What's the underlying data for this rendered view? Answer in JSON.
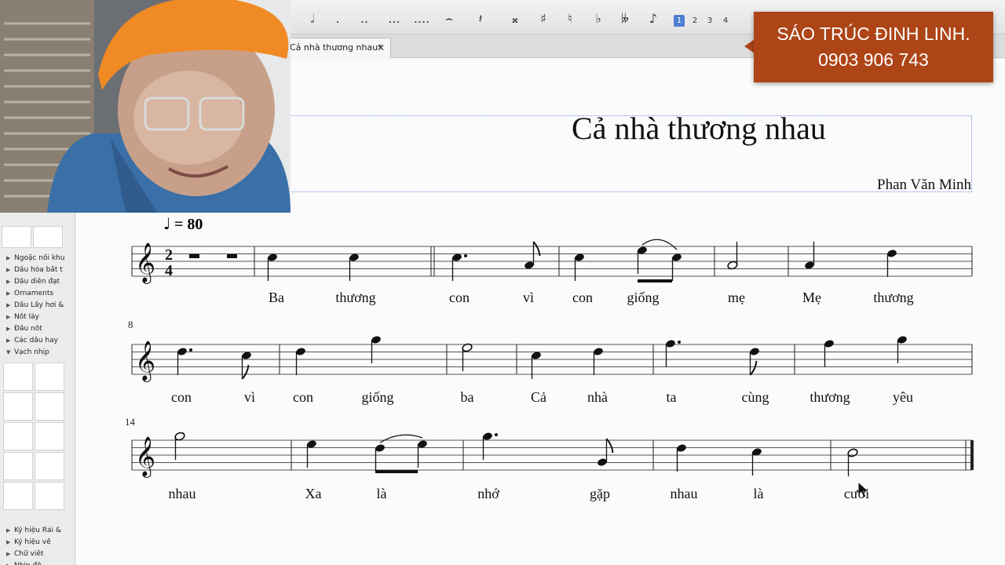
{
  "toolbar": {
    "buttons": [
      {
        "name": "half-note-button",
        "glyph": "𝅗𝅥"
      },
      {
        "name": "dot-button",
        "glyph": "."
      },
      {
        "name": "double-dot-button",
        "glyph": ".."
      },
      {
        "name": "triple-dot-button",
        "glyph": "..."
      },
      {
        "name": "quad-dot-button",
        "glyph": "...."
      },
      {
        "name": "tie-button",
        "glyph": "⌢"
      },
      {
        "name": "rest-button",
        "glyph": "𝄽"
      },
      {
        "name": "double-sharp-button",
        "glyph": "𝄪"
      },
      {
        "name": "sharp-button",
        "glyph": "♯"
      },
      {
        "name": "natural-button",
        "glyph": "♮"
      },
      {
        "name": "flat-button",
        "glyph": "♭"
      },
      {
        "name": "double-flat-button",
        "glyph": "𝄫"
      },
      {
        "name": "grace-note-button",
        "glyph": "♪"
      }
    ],
    "voices": [
      "1",
      "2",
      "3",
      "4"
    ]
  },
  "tab": {
    "label": "Cả nhà thương nhau*",
    "close": "✕"
  },
  "palette": {
    "rows": [
      "Ngoặc nối khu",
      "Dấu hóa bất t",
      "Dấu diễn đạt",
      "Ornaments",
      "Dấu Lấy hơi &",
      "Nốt láy",
      "Đầu nốt",
      "Các dấu hay",
      "Vạch nhịp"
    ],
    "bottom_rows": [
      "Ký hiệu Rải &",
      "Ký hiệu về",
      "Chữ viết",
      "Nhịp độ"
    ],
    "cell_glyph": "𝄴"
  },
  "score": {
    "title": "Cả nhà thương nhau",
    "composer": "Phan Văn Minh",
    "tempo_note": "♩",
    "tempo": "= 80",
    "time_signature": [
      "2",
      "4"
    ],
    "measure_numbers": [
      "8",
      "14"
    ],
    "lyrics": [
      [
        "Ba",
        "thương",
        "con",
        "vì",
        "con",
        "giống",
        "mẹ",
        "Mẹ",
        "thương"
      ],
      [
        "con",
        "vì",
        "con",
        "giống",
        "ba",
        "Cả",
        "nhà",
        "ta",
        "cùng",
        "thương",
        "yêu"
      ],
      [
        "nhau",
        "Xa",
        "là",
        "nhớ",
        "gặp",
        "nhau",
        "là",
        "cười"
      ]
    ]
  },
  "contact": {
    "line1": "SÁO TRÚC ĐINH LINH.",
    "line2": "0903 906 743",
    "background": "#ad4517"
  }
}
